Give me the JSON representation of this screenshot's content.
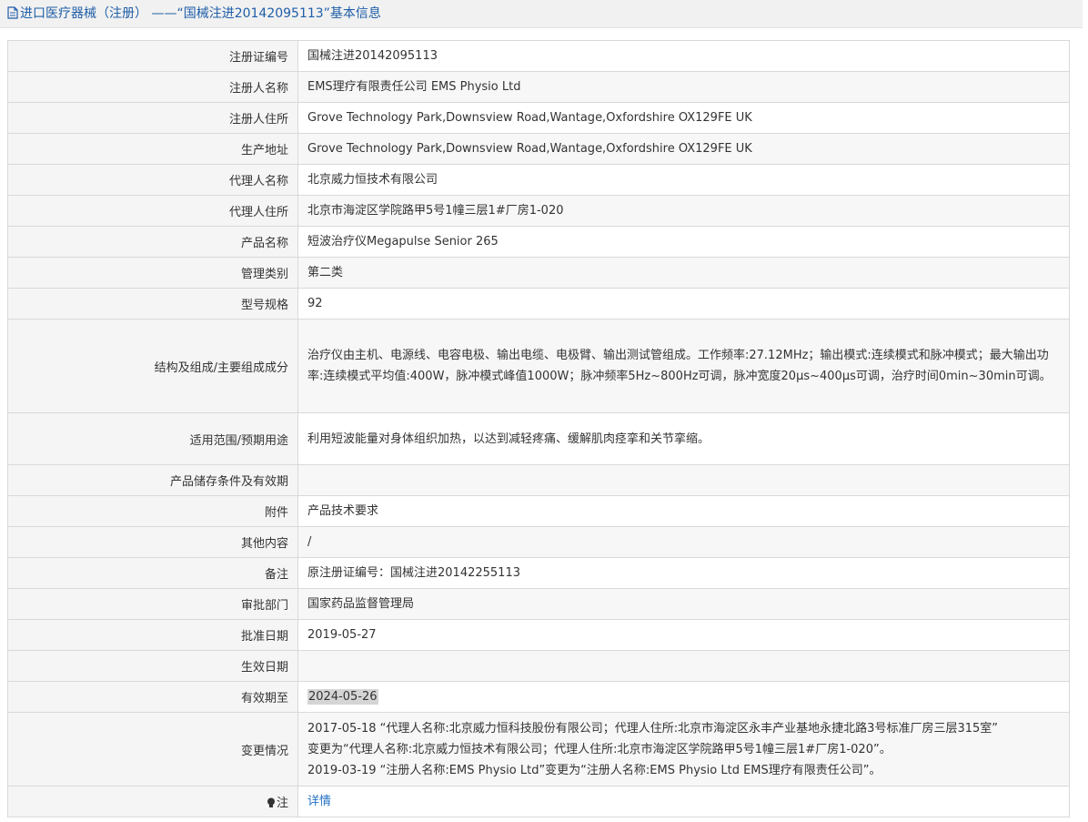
{
  "header": {
    "title": "进口医疗器械（注册） ——“国械注进20142095113”基本信息"
  },
  "rows": [
    {
      "label": "注册证编号",
      "value": "国械注进20142095113"
    },
    {
      "label": "注册人名称",
      "value": "EMS理疗有限责任公司 EMS Physio Ltd"
    },
    {
      "label": "注册人住所",
      "value": "Grove Technology Park,Downsview Road,Wantage,Oxfordshire OX129FE UK"
    },
    {
      "label": "生产地址",
      "value": "Grove Technology Park,Downsview Road,Wantage,Oxfordshire OX129FE UK"
    },
    {
      "label": "代理人名称",
      "value": "北京威力恒技术有限公司"
    },
    {
      "label": "代理人住所",
      "value": "北京市海淀区学院路甲5号1幢三层1#厂房1-020"
    },
    {
      "label": "产品名称",
      "value": "短波治疗仪Megapulse Senior 265"
    },
    {
      "label": "管理类别",
      "value": "第二类"
    },
    {
      "label": "型号规格",
      "value": "92"
    },
    {
      "label": "结构及组成/主要组成成分",
      "value": "治疗仪由主机、电源线、电容电极、输出电缆、电极臂、输出测试管组成。工作频率:27.12MHz；输出模式:连续模式和脉冲模式；最大输出功率:连续模式平均值:400W，脉冲模式峰值1000W；脉冲频率5Hz~800Hz可调，脉冲宽度20μs~400μs可调，治疗时间0min~30min可调。"
    },
    {
      "label": "适用范围/预期用途",
      "value": "利用短波能量对身体组织加热，以达到减轻疼痛、缓解肌肉痉挛和关节挛缩。"
    },
    {
      "label": "产品储存条件及有效期",
      "value": ""
    },
    {
      "label": "附件",
      "value": "产品技术要求"
    },
    {
      "label": "其他内容",
      "value": "/"
    },
    {
      "label": "备注",
      "value": "原注册证编号：国械注进20142255113"
    },
    {
      "label": "审批部门",
      "value": "国家药品监督管理局"
    },
    {
      "label": "批准日期",
      "value": "2019-05-27"
    },
    {
      "label": "生效日期",
      "value": ""
    },
    {
      "label": "有效期至",
      "value": "2024-05-26"
    },
    {
      "label": "变更情况",
      "value_lines": [
        "2017-05-18 “代理人名称:北京威力恒科技股份有限公司；代理人住所:北京市海淀区永丰产业基地永捷北路3号标准厂房三层315室”",
        "变更为“代理人名称:北京威力恒技术有限公司；代理人住所:北京市海淀区学院路甲5号1幢三层1#厂房1-020”。",
        "2019-03-19 “注册人名称:EMS Physio Ltd”变更为“注册人名称:EMS Physio Ltd EMS理疗有限责任公司”。"
      ]
    },
    {
      "label": "注",
      "link": "详情"
    }
  ],
  "icons": {
    "header": "document-icon",
    "note": "lightbulb-icon"
  }
}
